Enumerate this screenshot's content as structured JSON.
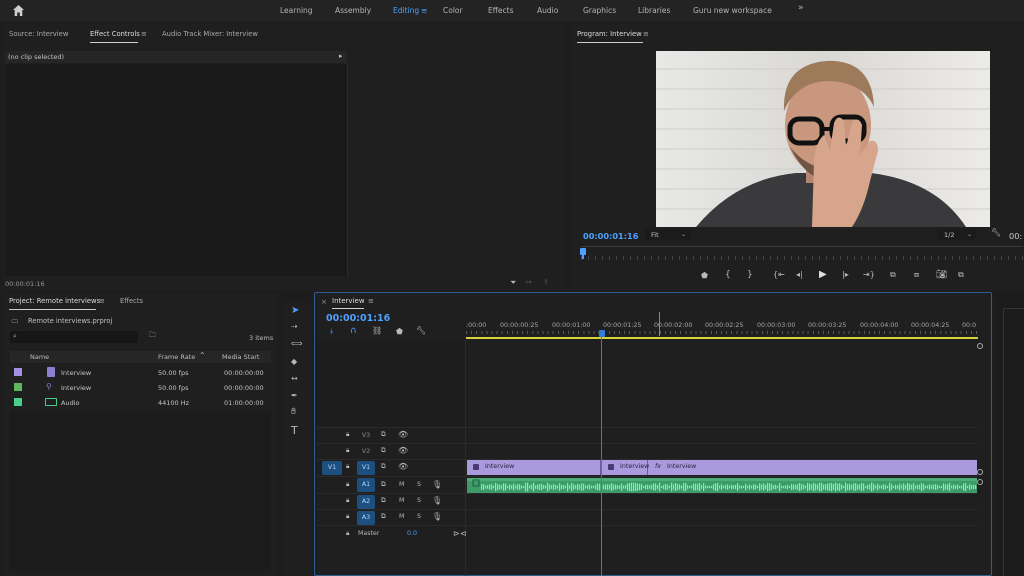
{
  "workspaces": [
    "Learning",
    "Assembly",
    "Editing",
    "Color",
    "Effects",
    "Audio",
    "Graphics",
    "Libraries",
    "Guru new workspace"
  ],
  "workspace_active": "Editing",
  "workspace_overflow": "»",
  "source_panel": {
    "tabs": [
      "Source: Interview",
      "Effect Controls",
      "Audio Track Mixer: Interview"
    ],
    "no_clip": "(no clip selected)",
    "timecode": "00:00:01:16"
  },
  "program_panel": {
    "title": "Program: Interview",
    "timecode": "00:00:01:16",
    "fit": "Fit",
    "resolution": "1/2",
    "timecode_right": "00:"
  },
  "project_panel": {
    "tabs": [
      "Project: Remote interviews",
      "Effects"
    ],
    "project_file": "Remote interviews.prproj",
    "item_count": "3 items",
    "columns": [
      "Name",
      "Frame Rate",
      "Media Start"
    ],
    "rows": [
      {
        "name": "Interview",
        "frame_rate": "50.00 fps",
        "media_start": "00:00:00:00",
        "color": "#a58fe0",
        "icon": "sequence-icon"
      },
      {
        "name": "Interview",
        "frame_rate": "50.00 fps",
        "media_start": "00:00:00:00",
        "color": "#5cb85c",
        "icon": "video-clip-icon"
      },
      {
        "name": "Audio",
        "frame_rate": "44100 Hz",
        "media_start": "01:00:00:00",
        "color": "#48d08a",
        "icon": "audio-clip-icon"
      }
    ]
  },
  "timeline": {
    "title": "Interview",
    "timecode": "00:00:01:16",
    "ruler": [
      ":00:00",
      "00:00:00:25",
      "00:00:01:00",
      "00:00:01:25",
      "00:00:02:00",
      "00:00:02:25",
      "00:00:03:00",
      "00:00:03:25",
      "00:00:04:00",
      "00:00:04:25",
      "00:0"
    ],
    "video_tracks": [
      "V3",
      "V2",
      "V1"
    ],
    "audio_tracks": [
      "A1",
      "A2",
      "A3"
    ],
    "v1_source": "V1",
    "mute": "M",
    "solo": "S",
    "master_label": "Master",
    "master_value": "0.0",
    "clips": [
      "Interview",
      "Interview",
      "Interview"
    ],
    "fx_badge": "fx"
  },
  "colors": {
    "accent": "#4ea0ff",
    "clip_video": "#a999dd",
    "clip_audio": "#3f9a6a",
    "playhead": "#2f7de1",
    "track_target": "#1d4f80"
  }
}
